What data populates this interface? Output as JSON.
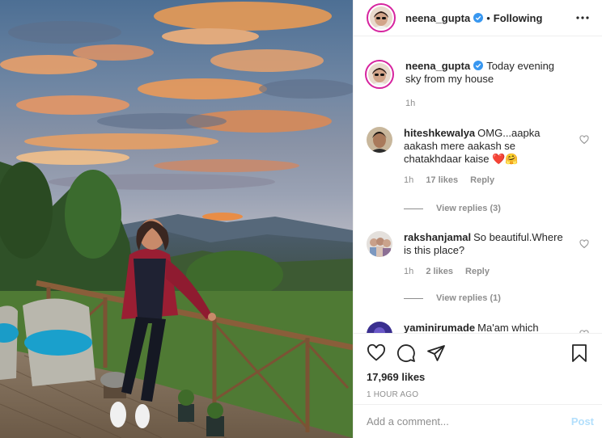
{
  "header": {
    "username": "neena_gupta",
    "separator": "•",
    "follow_state": "Following"
  },
  "caption": {
    "username": "neena_gupta",
    "text": "Today evening sky from my house",
    "time": "1h"
  },
  "comments": [
    {
      "username": "hiteshkewalya",
      "text": "OMG...aapka aakash mere aakash se chatakhdaar kaise",
      "emoji": "❤️🤗",
      "time": "1h",
      "likes": "17 likes",
      "reply": "Reply",
      "view_replies": "View replies (3)"
    },
    {
      "username": "rakshanjamal",
      "text": "So beautiful.Where is this place?",
      "time": "1h",
      "likes": "2 likes",
      "reply": "Reply",
      "view_replies": "View replies (1)"
    },
    {
      "username": "yaminirumade",
      "text": "Ma'am which"
    }
  ],
  "stats": {
    "likes": "17,969 likes",
    "posted": "1 HOUR AGO"
  },
  "add_comment": {
    "placeholder": "Add a comment...",
    "post_label": "Post"
  },
  "colors": {
    "verified": "#3897f0",
    "story_ring": "#d6249f",
    "post_disabled": "#b2dffc"
  }
}
